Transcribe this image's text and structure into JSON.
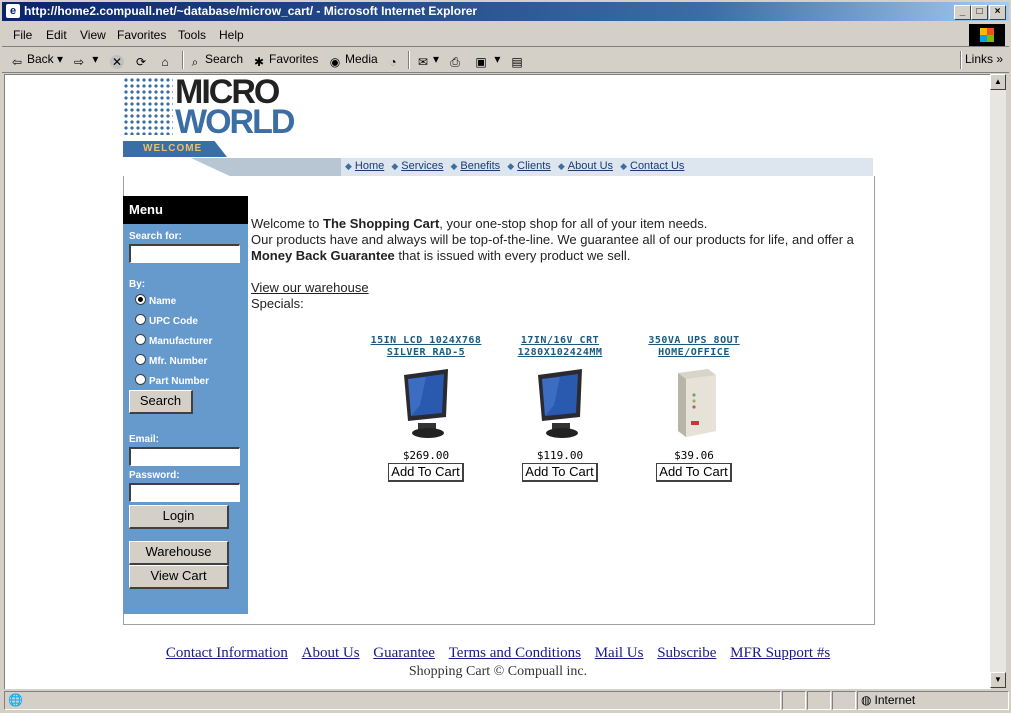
{
  "window": {
    "title": "http://home2.compuall.net/~database/microw_cart/ - Microsoft Internet Explorer"
  },
  "menubar": [
    "File",
    "Edit",
    "View",
    "Favorites",
    "Tools",
    "Help"
  ],
  "toolbar": {
    "back": "Back",
    "search": "Search",
    "favorites": "Favorites",
    "media": "Media",
    "links": "Links"
  },
  "logo": {
    "line1": "MICRO",
    "line2": "WORLD",
    "tab": "WELCOME"
  },
  "nav": [
    "Home",
    "Services",
    "Benefits",
    "Clients",
    "About Us",
    "Contact Us"
  ],
  "sidebar": {
    "menu_title": "Menu",
    "search_label": "Search for:",
    "by_label": "By:",
    "options": [
      "Name",
      "UPC Code",
      "Manufacturer",
      "Mfr. Number",
      "Part Number"
    ],
    "selected": "Name",
    "search_button": "Search",
    "email_label": "Email:",
    "password_label": "Password:",
    "login_button": "Login",
    "warehouse_button": "Warehouse",
    "viewcart_button": "View Cart"
  },
  "intro": {
    "p1a": "Welcome to ",
    "p1b": "The Shopping Cart",
    "p1c": ", your one-stop shop for all of your item needs.",
    "p2a": "Our products have and always will be top-of-the-line. We guarantee all of our products for life, and offer a ",
    "p2b": "Money Back Guarantee",
    "p2c": " that is issued with every product we sell.",
    "warehouse_link": "View our warehouse",
    "specials": "Specials:"
  },
  "products": [
    {
      "name1": "15IN LCD 1024X768",
      "name2": "SILVER RAD-5",
      "price": "$269.00",
      "button": "Add To Cart"
    },
    {
      "name1": "17IN/16V CRT",
      "name2": "1280X102424MM",
      "price": "$119.00",
      "button": "Add To Cart"
    },
    {
      "name1": "350VA UPS 8OUT",
      "name2": "HOME/OFFICE",
      "price": "$39.06",
      "button": "Add To Cart"
    }
  ],
  "footer": {
    "links": [
      "Contact Information",
      "About Us",
      "Guarantee",
      "Terms and Conditions",
      "Mail Us",
      "Subscribe",
      "MFR Support #s"
    ],
    "copyright": "Shopping Cart © Compuall inc."
  },
  "status": {
    "zone": "Internet"
  }
}
